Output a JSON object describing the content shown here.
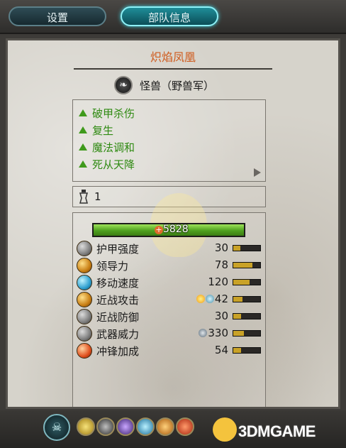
{
  "tabs": [
    {
      "label": "设置",
      "active": false
    },
    {
      "label": "部队信息",
      "active": true
    }
  ],
  "unit": {
    "name": "炽焰凤凰",
    "type": "怪兽（野兽军）"
  },
  "abilities": [
    {
      "label": "破甲杀伤"
    },
    {
      "label": "复生"
    },
    {
      "label": "魔法调和"
    },
    {
      "label": "死从天降"
    }
  ],
  "unit_count": "1",
  "hp": "5828",
  "stats": [
    {
      "label": "护甲强度",
      "value": "30",
      "bar": 0.25,
      "icon": "armor-icon"
    },
    {
      "label": "领导力",
      "value": "78",
      "bar": 0.7,
      "icon": "leadership-icon"
    },
    {
      "label": "移动速度",
      "value": "120",
      "bar": 0.6,
      "icon": "speed-icon"
    },
    {
      "label": "近战攻击",
      "value": "42",
      "bar": 0.35,
      "icon": "melee-attack-icon"
    },
    {
      "label": "近战防御",
      "value": "30",
      "bar": 0.3,
      "icon": "melee-defense-icon"
    },
    {
      "label": "武器威力",
      "value": "330",
      "bar": 0.4,
      "icon": "weapon-strength-icon"
    },
    {
      "label": "冲锋加成",
      "value": "54",
      "bar": 0.3,
      "icon": "charge-bonus-icon"
    }
  ],
  "watermark": "3DMGAME",
  "colors": {
    "unit_name": "#cf5a1c",
    "ability": "#2f8a12",
    "hp_bar": "#4fa11f",
    "active_tab": "#1f8e99"
  }
}
